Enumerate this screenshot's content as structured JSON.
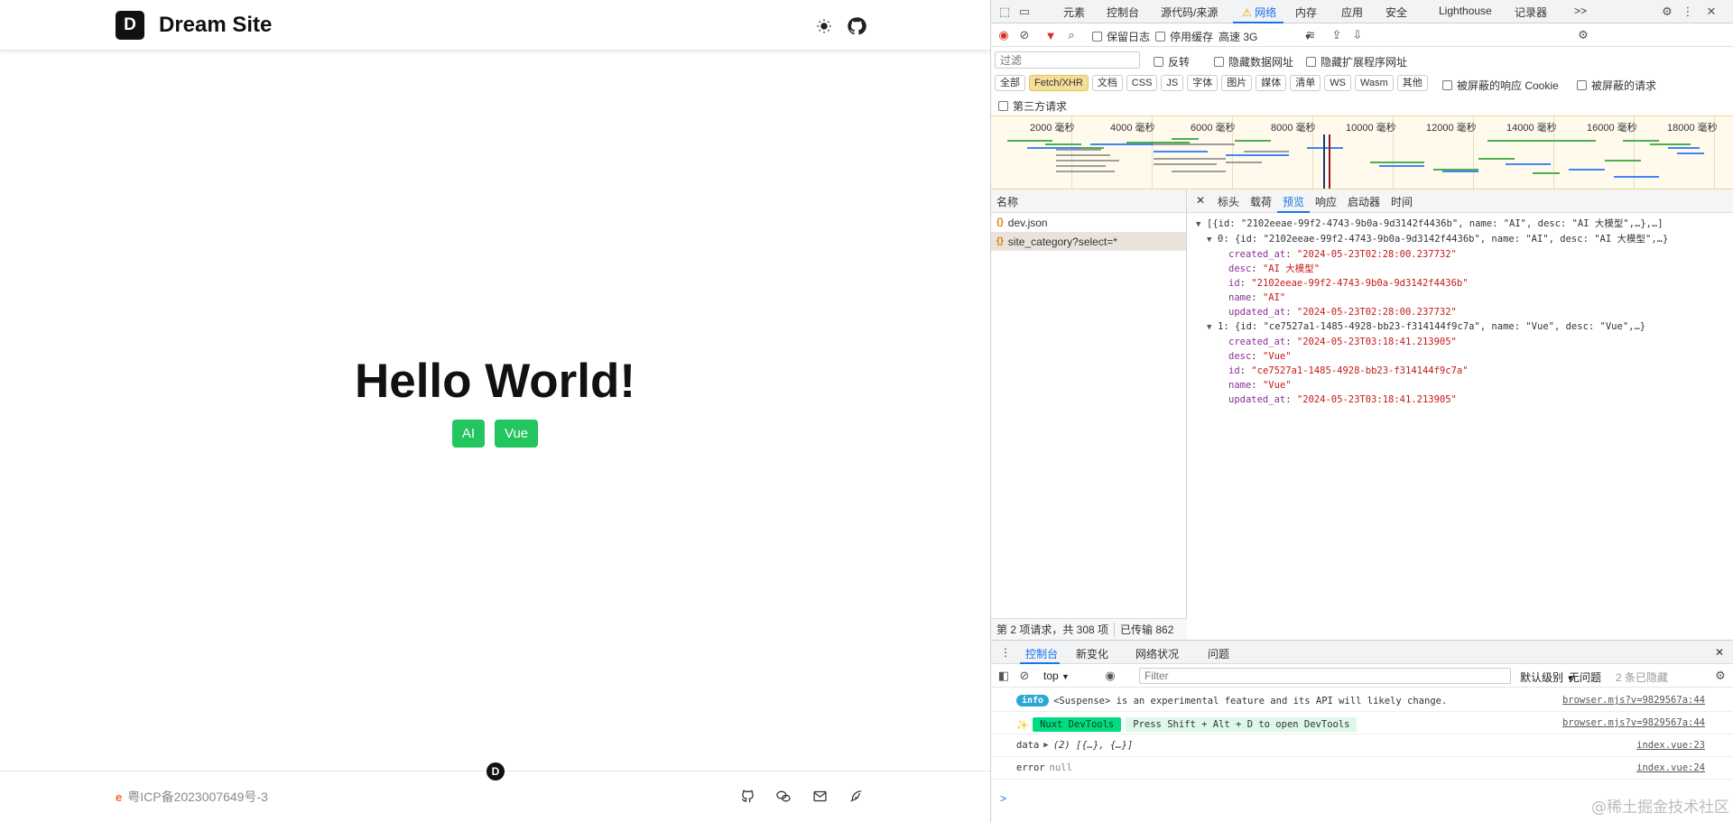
{
  "site": {
    "logo_letter": "D",
    "name": "Dream Site",
    "hero_title": "Hello World!",
    "tags": [
      "AI",
      "Vue"
    ],
    "footer_logo_letter": "D",
    "icp_text": "粤ICP备2023007649号-3",
    "colors": {
      "tag": "#22c55e",
      "text": "#111111"
    },
    "icons": [
      "sun-icon",
      "github-icon",
      "github-icon",
      "wechat-icon",
      "mail-icon",
      "feather-icon"
    ]
  },
  "devtools": {
    "tabs": [
      "元素",
      "控制台",
      "源代码/来源",
      "网络",
      "内存",
      "应用",
      "安全",
      "Lighthouse",
      "记录器"
    ],
    "active_tab": "网络",
    "more_tabs": ">>",
    "toolbar": {
      "preserve_log": "保留日志",
      "disable_cache": "停用缓存",
      "throttle": "高速 3G"
    },
    "filter": {
      "placeholder": "过滤",
      "invert": "反转",
      "hide_data_urls": "隐藏数据网址",
      "hide_ext_urls": "隐藏扩展程序网址"
    },
    "types": [
      "全部",
      "Fetch/XHR",
      "文档",
      "CSS",
      "JS",
      "字体",
      "图片",
      "媒体",
      "清单",
      "WS",
      "Wasm",
      "其他"
    ],
    "active_type": "Fetch/XHR",
    "blocked_cookies": "被屏蔽的响应 Cookie",
    "blocked_requests": "被屏蔽的请求",
    "third_party": "第三方请求",
    "timeline_ticks": [
      "2000 毫秒",
      "4000 毫秒",
      "6000 毫秒",
      "8000 毫秒",
      "10000 毫秒",
      "12000 毫秒",
      "14000 毫秒",
      "16000 毫秒",
      "18000 毫秒"
    ],
    "requests": {
      "header": "名称",
      "items": [
        "dev.json",
        "site_category?select=*"
      ],
      "status_count": "第 2 项请求，共 308 项",
      "status_transferred": "已传输 862"
    },
    "detail_tabs": [
      "标头",
      "载荷",
      "预览",
      "响应",
      "启动器",
      "时间"
    ],
    "active_detail_tab": "预览",
    "preview": {
      "root": "[{id: \"2102eeae-99f2-4743-9b0a-9d3142f4436b\", name: \"AI\", desc: \"AI 大模型\",…},…]",
      "item0_summary": "0: {id: \"2102eeae-99f2-4743-9b0a-9d3142f4436b\", name: \"AI\", desc: \"AI 大模型\",…}",
      "item0": {
        "created_at": "\"2024-05-23T02:28:00.237732\"",
        "desc": "\"AI 大模型\"",
        "id": "\"2102eeae-99f2-4743-9b0a-9d3142f4436b\"",
        "name": "\"AI\"",
        "updated_at": "\"2024-05-23T02:28:00.237732\""
      },
      "item1_summary": "1: {id: \"ce7527a1-1485-4928-bb23-f314144f9c7a\", name: \"Vue\", desc: \"Vue\",…}",
      "item1": {
        "created_at": "\"2024-05-23T03:18:41.213905\"",
        "desc": "\"Vue\"",
        "id": "\"ce7527a1-1485-4928-bb23-f314144f9c7a\"",
        "name": "\"Vue\"",
        "updated_at": "\"2024-05-23T03:18:41.213905\""
      }
    },
    "console": {
      "tabs": [
        "控制台",
        "新变化",
        "网络状况",
        "问题"
      ],
      "active_tab": "控制台",
      "context": "top",
      "filter_placeholder": "Filter",
      "level": "默认级别",
      "issues": "无问题",
      "hidden": "2 条已隐藏",
      "logs": [
        {
          "badge": "info",
          "text": "<Suspense> is an experimental feature and its API will likely change.",
          "src": "browser.mjs?v=9829567a:44"
        },
        {
          "badge": "Nuxt DevTools",
          "text": "Press Shift + Alt + D to open DevTools",
          "src": "browser.mjs?v=9829567a:44"
        },
        {
          "label": "data",
          "text": "(2) [{…}, {…}]",
          "src": "index.vue:23"
        },
        {
          "label": "error",
          "text": "null",
          "src": "index.vue:24"
        }
      ],
      "prompt": ">"
    },
    "watermark": "@稀土掘金技术社区"
  }
}
